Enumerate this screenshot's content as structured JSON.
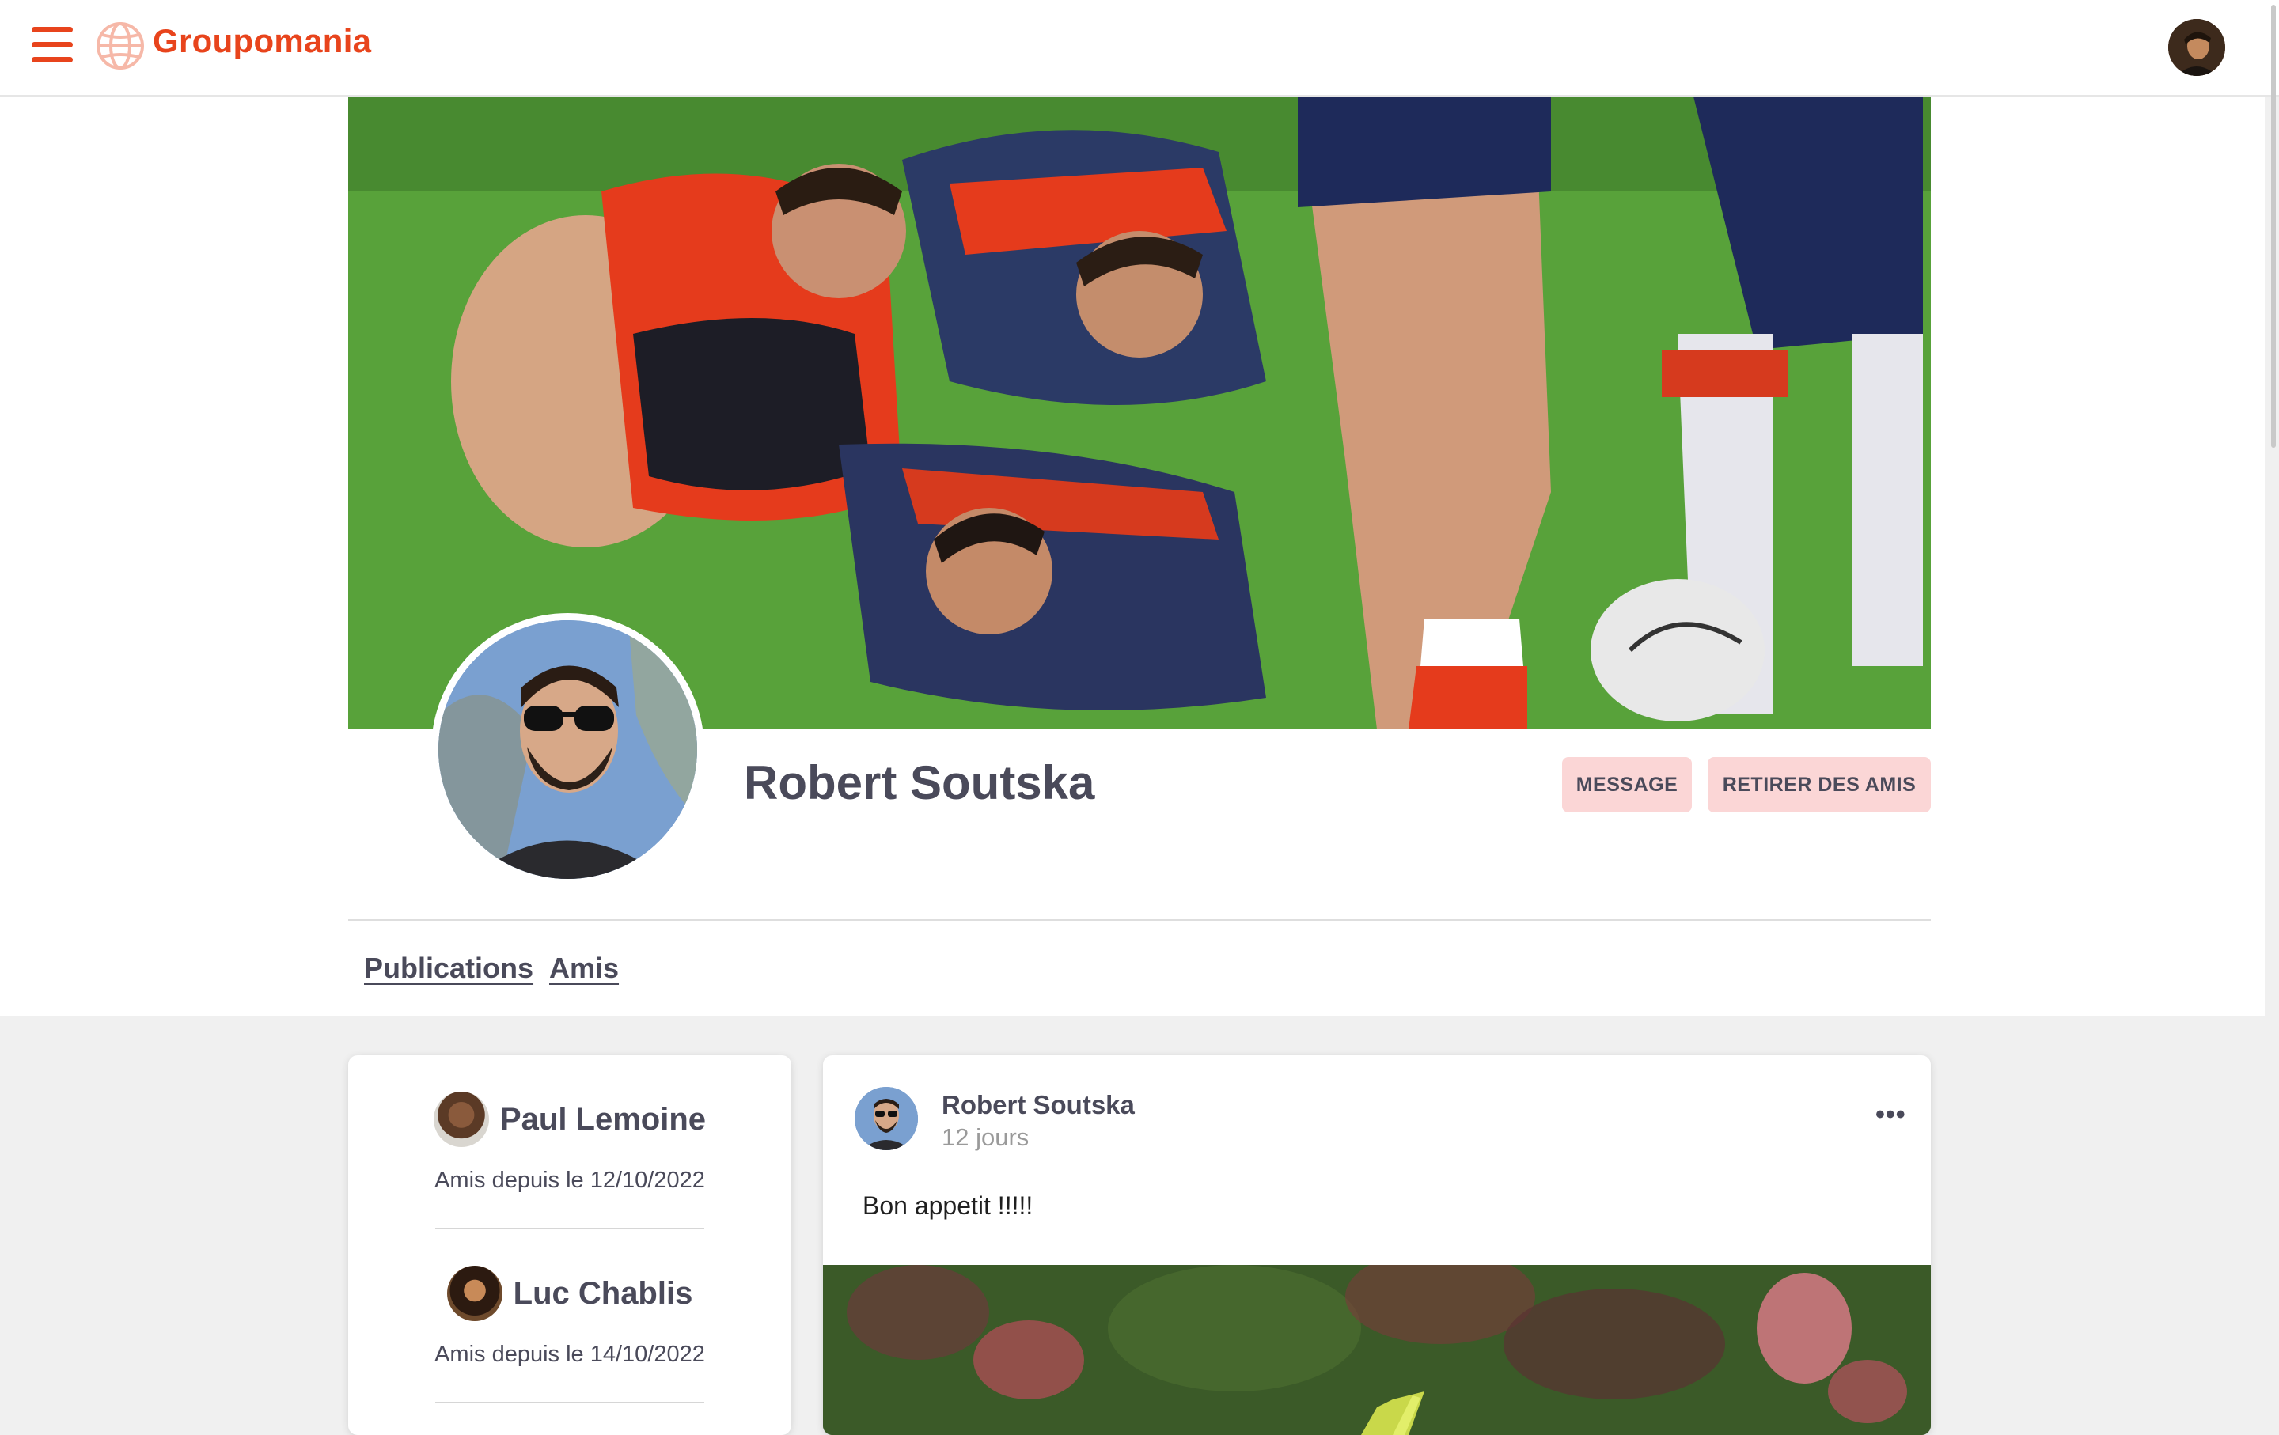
{
  "header": {
    "brand": "Groupomania",
    "menu_icon": "hamburger-menu-icon",
    "logo_icon": "globe-icon",
    "user_avatar": "user-avatar",
    "accent_color": "#e8441c"
  },
  "profile": {
    "name": "Robert Soutska",
    "cover": "rugby-scrum-cover-photo",
    "buttons": {
      "message": "MESSAGE",
      "remove_friend": "RETIRER DES AMIS"
    },
    "button_color": "#fbd6d6"
  },
  "tabs": [
    {
      "label": "Publications"
    },
    {
      "label": "Amis"
    }
  ],
  "friends": [
    {
      "name": "Paul Lemoine",
      "since": "Amis depuis le 12/10/2022"
    },
    {
      "name": "Luc Chablis",
      "since": "Amis depuis le 14/10/2022"
    }
  ],
  "post": {
    "author": "Robert Soutska",
    "time": "12 jours",
    "text": "Bon appetit !!!!!",
    "menu_icon": "more-options-icon",
    "image": "food-photo"
  }
}
